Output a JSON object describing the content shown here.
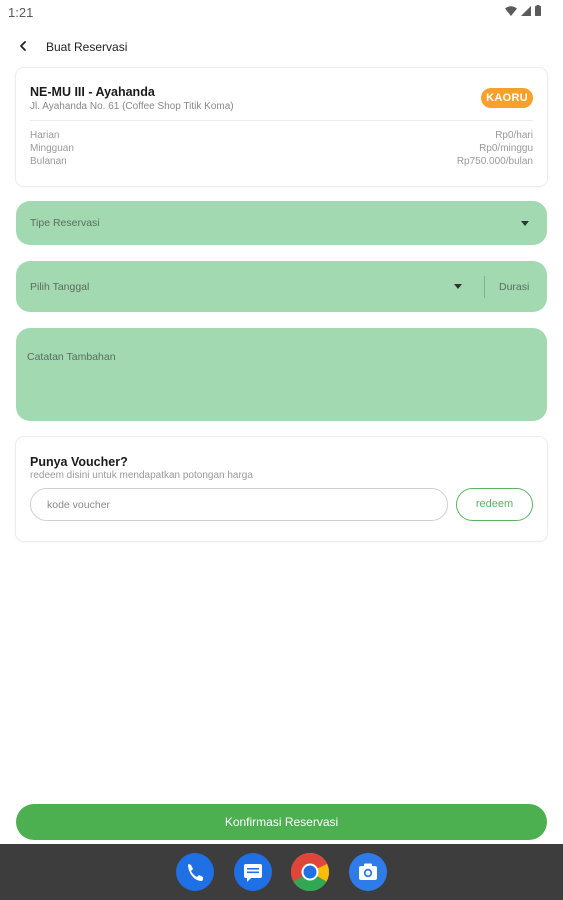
{
  "status_bar": {
    "time": "1:21"
  },
  "app_bar": {
    "title": "Buat Reservasi"
  },
  "venue": {
    "name": "NE-MU III - Ayahanda",
    "address": "Jl. Ayahanda No. 61 (Coffee Shop Titik Koma)",
    "badge": "KAORU",
    "prices": [
      {
        "label": "Harian",
        "value": "Rp0/hari"
      },
      {
        "label": "Mingguan",
        "value": "Rp0/minggu"
      },
      {
        "label": "Bulanan",
        "value": "Rp750.000/bulan"
      }
    ]
  },
  "form": {
    "tipe_reservasi": "Tipe Reservasi",
    "pilih_tanggal": "Pilih Tanggal",
    "durasi": "Durasi",
    "catatan": "Catatan Tambahan"
  },
  "voucher": {
    "title": "Punya Voucher?",
    "subtitle": "redeem disini untuk mendapatkan potongan harga",
    "placeholder": "kode voucher",
    "redeem_label": "redeem"
  },
  "confirm_label": "Konfirmasi Reservasi",
  "colors": {
    "field_bg": "#a2d9b1",
    "primary_green": "#4caf50",
    "badge_orange": "#f7a02a"
  },
  "dock": [
    "phone-icon",
    "messages-icon",
    "chrome-icon",
    "camera-icon"
  ]
}
